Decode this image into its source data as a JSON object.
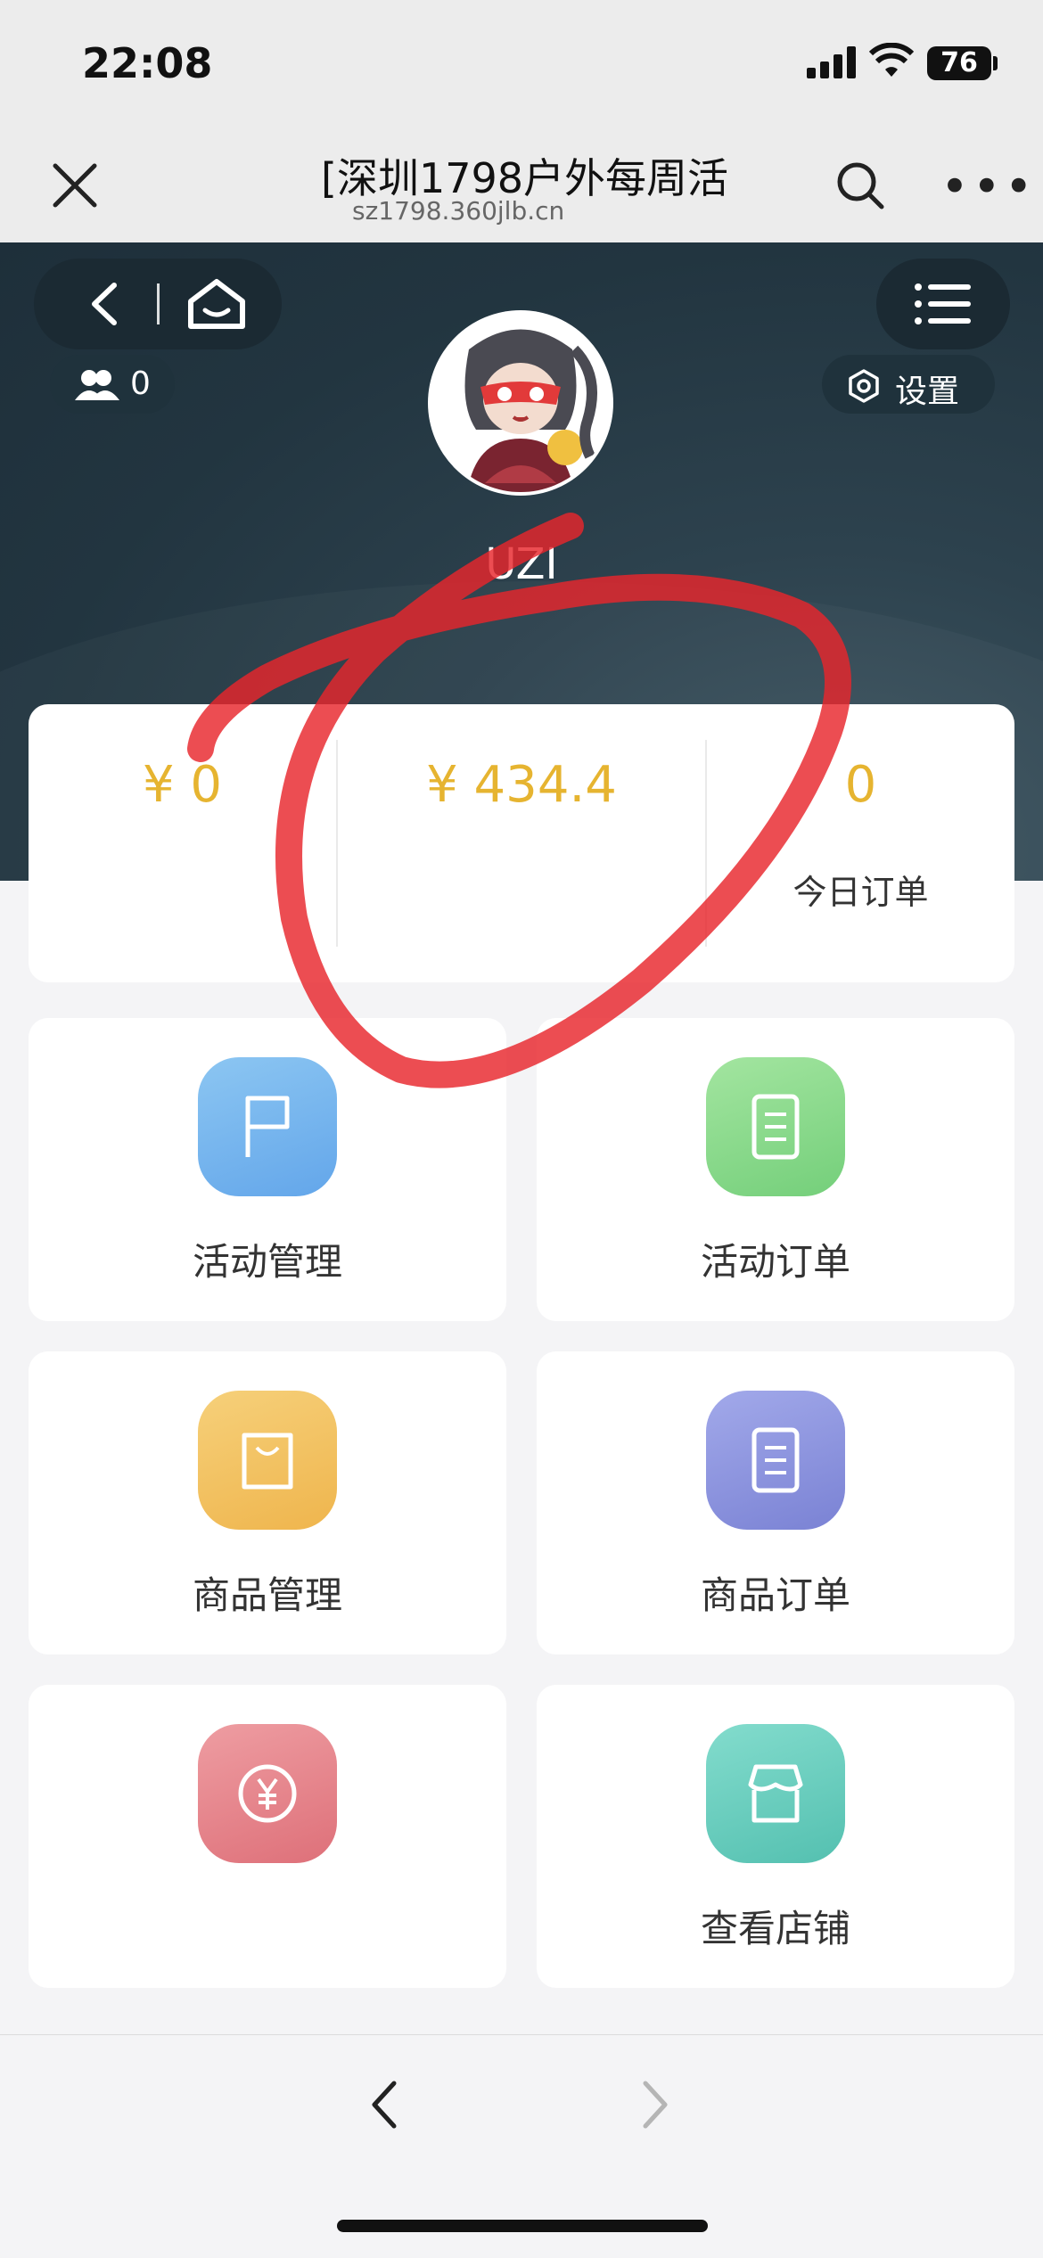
{
  "status_bar": {
    "time": "22:08",
    "battery": "76"
  },
  "browser": {
    "title": "[深圳1798户外每周活",
    "url": "sz1798.360jlb.cn"
  },
  "profile": {
    "followers": "0",
    "settings_label": "设置",
    "username": "UZI"
  },
  "stats": [
    {
      "value": "¥ 0",
      "label": ""
    },
    {
      "value": "¥ 434.4",
      "label": ""
    },
    {
      "value": "0",
      "label": "今日订单"
    }
  ],
  "tiles": [
    {
      "label": "活动管理",
      "icon": "flag-icon",
      "color": "#7ab7ef"
    },
    {
      "label": "活动订单",
      "icon": "document-icon",
      "color": "#8fdc8f"
    },
    {
      "label": "商品管理",
      "icon": "shopping-bag-icon",
      "color": "#f2c567"
    },
    {
      "label": "商品订单",
      "icon": "document-icon",
      "color": "#8d96e0"
    },
    {
      "label": "",
      "icon": "yen-icon",
      "color": "#e8878e"
    },
    {
      "label": "查看店铺",
      "icon": "store-icon",
      "color": "#6fd2c2"
    }
  ],
  "colors": {
    "accent": "#e6b430",
    "header_bg": "#223540",
    "annotation": "#e8262c"
  }
}
